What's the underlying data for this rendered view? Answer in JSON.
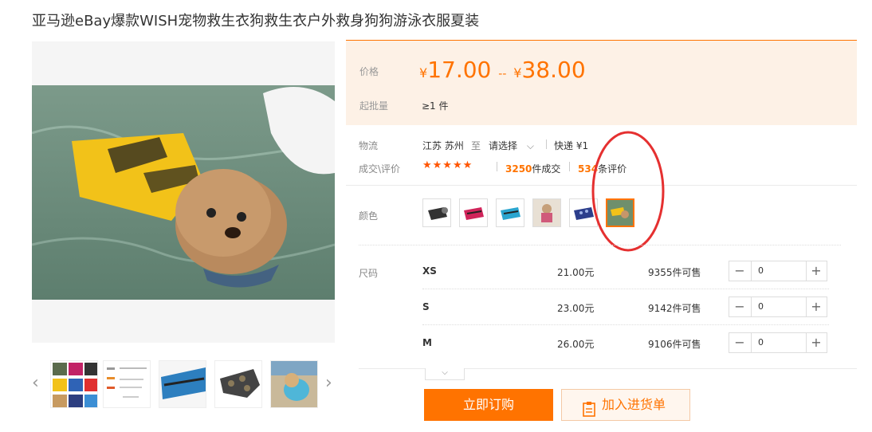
{
  "title": "亚马逊eBay爆款WISH宠物救生衣狗救生衣户外救身狗狗游泳衣服夏装",
  "price": {
    "label": "价格",
    "currency": "¥",
    "low": "17.00",
    "sep": "--",
    "high": "38.00"
  },
  "moq": {
    "label": "起批量",
    "value": "≥1 件"
  },
  "logistics": {
    "label": "物流",
    "origin": "江苏 苏州",
    "to": "至",
    "dest": "请选择",
    "shipping": "快递 ¥1"
  },
  "sales": {
    "label": "成交\\评价",
    "stars": "★★★★★",
    "deals_count": "3250",
    "deals_unit": "件成交",
    "reviews_count": "534",
    "reviews_unit": "条评价"
  },
  "color": {
    "label": "颜色",
    "selected_index": 5
  },
  "size": {
    "label": "尺码",
    "rows": [
      {
        "name": "XS",
        "price": "21.00元",
        "stock": "9355件可售",
        "qty": "0"
      },
      {
        "name": "S",
        "price": "23.00元",
        "stock": "9142件可售",
        "qty": "0"
      },
      {
        "name": "M",
        "price": "26.00元",
        "stock": "9106件可售",
        "qty": "0"
      }
    ]
  },
  "actions": {
    "buy": "立即订购",
    "cart": "加入进货单"
  },
  "icons": [
    "chevron-down-icon",
    "minus-icon",
    "plus-icon",
    "clipboard-icon",
    "arrow-left-icon",
    "arrow-right-icon"
  ],
  "colors": {
    "accent": "#ff7300",
    "price_bg": "#fdf1e6",
    "annotation": "#e53030"
  }
}
